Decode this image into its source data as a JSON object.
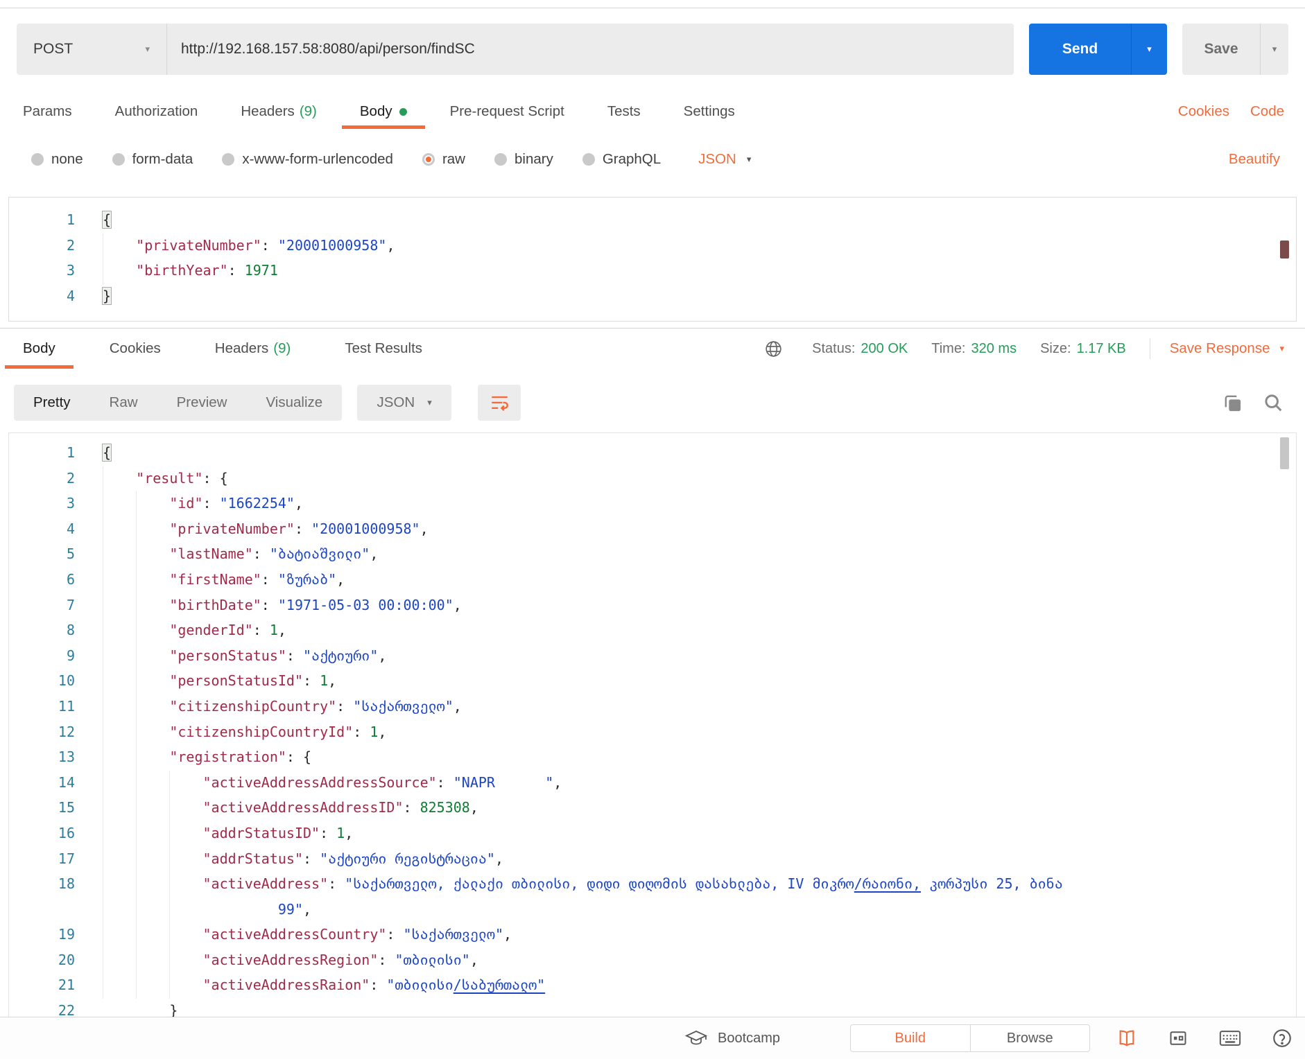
{
  "request": {
    "method": "POST",
    "url": "http://192.168.157.58:8080/api/person/findSC",
    "send_label": "Send",
    "save_label": "Save",
    "tabs": [
      {
        "label": "Params"
      },
      {
        "label": "Authorization"
      },
      {
        "label": "Headers",
        "count": "(9)"
      },
      {
        "label": "Body",
        "active": true
      },
      {
        "label": "Pre-request Script"
      },
      {
        "label": "Tests"
      },
      {
        "label": "Settings"
      }
    ],
    "links": {
      "cookies": "Cookies",
      "code": "Code"
    },
    "body_modes": [
      {
        "label": "none"
      },
      {
        "label": "form-data"
      },
      {
        "label": "x-www-form-urlencoded"
      },
      {
        "label": "raw",
        "selected": true
      },
      {
        "label": "binary"
      },
      {
        "label": "GraphQL"
      }
    ],
    "language": "JSON",
    "beautify_label": "Beautify",
    "editor_lines": [
      {
        "n": "1",
        "s": [
          {
            "t": "{",
            "c": "p",
            "hl": true
          }
        ]
      },
      {
        "n": "2",
        "s": [
          {
            "t": "    ",
            "c": "p"
          },
          {
            "t": "\"privateNumber\"",
            "c": "k"
          },
          {
            "t": ": ",
            "c": "p"
          },
          {
            "t": "\"20001000958\"",
            "c": "s"
          },
          {
            "t": ",",
            "c": "p"
          }
        ]
      },
      {
        "n": "3",
        "s": [
          {
            "t": "    ",
            "c": "p"
          },
          {
            "t": "\"birthYear\"",
            "c": "k"
          },
          {
            "t": ": ",
            "c": "p"
          },
          {
            "t": "1971",
            "c": "n"
          }
        ]
      },
      {
        "n": "4",
        "s": [
          {
            "t": "}",
            "c": "p",
            "hl": true
          }
        ]
      }
    ]
  },
  "response": {
    "tabs": [
      {
        "label": "Body",
        "active": true
      },
      {
        "label": "Cookies"
      },
      {
        "label": "Headers",
        "count": "(9)"
      },
      {
        "label": "Test Results"
      }
    ],
    "meta": {
      "status_label": "Status:",
      "status": "200 OK",
      "time_label": "Time:",
      "time": "320 ms",
      "size_label": "Size:",
      "size": "1.17 KB"
    },
    "save_response_label": "Save Response",
    "views": [
      {
        "label": "Pretty",
        "active": true
      },
      {
        "label": "Raw"
      },
      {
        "label": "Preview"
      },
      {
        "label": "Visualize"
      }
    ],
    "language": "JSON",
    "editor_lines": [
      {
        "n": "1",
        "s": [
          {
            "t": "{",
            "c": "p",
            "hl": true
          }
        ]
      },
      {
        "n": "2",
        "s": [
          {
            "t": "    ",
            "c": "p"
          },
          {
            "t": "\"result\"",
            "c": "k"
          },
          {
            "t": ": {",
            "c": "p"
          }
        ]
      },
      {
        "n": "3",
        "s": [
          {
            "t": "        ",
            "c": "p"
          },
          {
            "t": "\"id\"",
            "c": "k"
          },
          {
            "t": ": ",
            "c": "p"
          },
          {
            "t": "\"1662254\"",
            "c": "s"
          },
          {
            "t": ",",
            "c": "p"
          }
        ]
      },
      {
        "n": "4",
        "s": [
          {
            "t": "        ",
            "c": "p"
          },
          {
            "t": "\"privateNumber\"",
            "c": "k"
          },
          {
            "t": ": ",
            "c": "p"
          },
          {
            "t": "\"20001000958\"",
            "c": "s"
          },
          {
            "t": ",",
            "c": "p"
          }
        ]
      },
      {
        "n": "5",
        "s": [
          {
            "t": "        ",
            "c": "p"
          },
          {
            "t": "\"lastName\"",
            "c": "k"
          },
          {
            "t": ": ",
            "c": "p"
          },
          {
            "t": "\"ბატიაშვილი\"",
            "c": "s"
          },
          {
            "t": ",",
            "c": "p"
          }
        ]
      },
      {
        "n": "6",
        "s": [
          {
            "t": "        ",
            "c": "p"
          },
          {
            "t": "\"firstName\"",
            "c": "k"
          },
          {
            "t": ": ",
            "c": "p"
          },
          {
            "t": "\"ზურაბ\"",
            "c": "s"
          },
          {
            "t": ",",
            "c": "p"
          }
        ]
      },
      {
        "n": "7",
        "s": [
          {
            "t": "        ",
            "c": "p"
          },
          {
            "t": "\"birthDate\"",
            "c": "k"
          },
          {
            "t": ": ",
            "c": "p"
          },
          {
            "t": "\"1971-05-03 00:00:00\"",
            "c": "s"
          },
          {
            "t": ",",
            "c": "p"
          }
        ]
      },
      {
        "n": "8",
        "s": [
          {
            "t": "        ",
            "c": "p"
          },
          {
            "t": "\"genderId\"",
            "c": "k"
          },
          {
            "t": ": ",
            "c": "p"
          },
          {
            "t": "1",
            "c": "n"
          },
          {
            "t": ",",
            "c": "p"
          }
        ]
      },
      {
        "n": "9",
        "s": [
          {
            "t": "        ",
            "c": "p"
          },
          {
            "t": "\"personStatus\"",
            "c": "k"
          },
          {
            "t": ": ",
            "c": "p"
          },
          {
            "t": "\"აქტიური\"",
            "c": "s"
          },
          {
            "t": ",",
            "c": "p"
          }
        ]
      },
      {
        "n": "10",
        "s": [
          {
            "t": "        ",
            "c": "p"
          },
          {
            "t": "\"personStatusId\"",
            "c": "k"
          },
          {
            "t": ": ",
            "c": "p"
          },
          {
            "t": "1",
            "c": "n"
          },
          {
            "t": ",",
            "c": "p"
          }
        ]
      },
      {
        "n": "11",
        "s": [
          {
            "t": "        ",
            "c": "p"
          },
          {
            "t": "\"citizenshipCountry\"",
            "c": "k"
          },
          {
            "t": ": ",
            "c": "p"
          },
          {
            "t": "\"საქართველო\"",
            "c": "s"
          },
          {
            "t": ",",
            "c": "p"
          }
        ]
      },
      {
        "n": "12",
        "s": [
          {
            "t": "        ",
            "c": "p"
          },
          {
            "t": "\"citizenshipCountryId\"",
            "c": "k"
          },
          {
            "t": ": ",
            "c": "p"
          },
          {
            "t": "1",
            "c": "n"
          },
          {
            "t": ",",
            "c": "p"
          }
        ]
      },
      {
        "n": "13",
        "s": [
          {
            "t": "        ",
            "c": "p"
          },
          {
            "t": "\"registration\"",
            "c": "k"
          },
          {
            "t": ": {",
            "c": "p"
          }
        ]
      },
      {
        "n": "14",
        "s": [
          {
            "t": "            ",
            "c": "p"
          },
          {
            "t": "\"activeAddressAddressSource\"",
            "c": "k"
          },
          {
            "t": ": ",
            "c": "p"
          },
          {
            "t": "\"NAPR      \"",
            "c": "s"
          },
          {
            "t": ",",
            "c": "p"
          }
        ]
      },
      {
        "n": "15",
        "s": [
          {
            "t": "            ",
            "c": "p"
          },
          {
            "t": "\"activeAddressAddressID\"",
            "c": "k"
          },
          {
            "t": ": ",
            "c": "p"
          },
          {
            "t": "825308",
            "c": "n"
          },
          {
            "t": ",",
            "c": "p"
          }
        ]
      },
      {
        "n": "16",
        "s": [
          {
            "t": "            ",
            "c": "p"
          },
          {
            "t": "\"addrStatusID\"",
            "c": "k"
          },
          {
            "t": ": ",
            "c": "p"
          },
          {
            "t": "1",
            "c": "n"
          },
          {
            "t": ",",
            "c": "p"
          }
        ]
      },
      {
        "n": "17",
        "s": [
          {
            "t": "            ",
            "c": "p"
          },
          {
            "t": "\"addrStatus\"",
            "c": "k"
          },
          {
            "t": ": ",
            "c": "p"
          },
          {
            "t": "\"აქტიური რეგისტრაცია\"",
            "c": "s"
          },
          {
            "t": ",",
            "c": "p"
          }
        ]
      },
      {
        "n": "18",
        "s": [
          {
            "t": "            ",
            "c": "p"
          },
          {
            "t": "\"activeAddress\"",
            "c": "k"
          },
          {
            "t": ": ",
            "c": "p"
          },
          {
            "t": "\"საქართველო, ქალაქი თბილისი, დიდი დიღომის დასახლება, IV მიკრო",
            "c": "s"
          },
          {
            "t": "/რაიონი,",
            "c": "l"
          },
          {
            "t": " კორპუსი 25, ბინა ",
            "c": "s"
          }
        ]
      },
      {
        "n": "",
        "s": [
          {
            "t": "                     ",
            "c": "p"
          },
          {
            "t": "99\"",
            "c": "s"
          },
          {
            "t": ",",
            "c": "p"
          }
        ]
      },
      {
        "n": "19",
        "s": [
          {
            "t": "            ",
            "c": "p"
          },
          {
            "t": "\"activeAddressCountry\"",
            "c": "k"
          },
          {
            "t": ": ",
            "c": "p"
          },
          {
            "t": "\"საქართველო\"",
            "c": "s"
          },
          {
            "t": ",",
            "c": "p"
          }
        ]
      },
      {
        "n": "20",
        "s": [
          {
            "t": "            ",
            "c": "p"
          },
          {
            "t": "\"activeAddressRegion\"",
            "c": "k"
          },
          {
            "t": ": ",
            "c": "p"
          },
          {
            "t": "\"თბილისი\"",
            "c": "s"
          },
          {
            "t": ",",
            "c": "p"
          }
        ]
      },
      {
        "n": "21",
        "s": [
          {
            "t": "            ",
            "c": "p"
          },
          {
            "t": "\"activeAddressRaion\"",
            "c": "k"
          },
          {
            "t": ": ",
            "c": "p"
          },
          {
            "t": "\"თბილისი",
            "c": "s"
          },
          {
            "t": "/საბურთალო\"",
            "c": "l"
          }
        ]
      },
      {
        "n": "22",
        "s": [
          {
            "t": "        ",
            "c": "p"
          },
          {
            "t": "}",
            "c": "p"
          }
        ]
      }
    ]
  },
  "footer": {
    "bootcamp_label": "Bootcamp",
    "build_label": "Build",
    "browse_label": "Browse"
  },
  "icons": {
    "caret_down": "▾"
  },
  "colors": {
    "accent_orange": "#F26B3B",
    "send_blue": "#1673E2",
    "success_green": "#259D58"
  }
}
